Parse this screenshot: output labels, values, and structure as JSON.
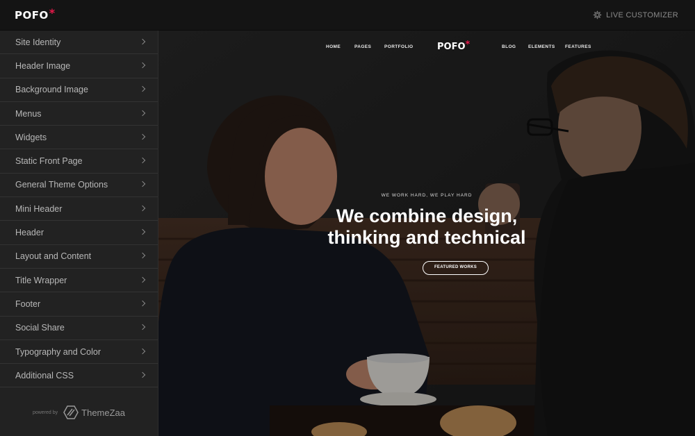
{
  "topbar": {
    "brand": "POFO",
    "brand_mark": "*",
    "live_label": "LIVE CUSTOMIZER",
    "live_icon": "gear-icon"
  },
  "sidebar": {
    "items": [
      {
        "label": "Site Identity"
      },
      {
        "label": "Header Image"
      },
      {
        "label": "Background Image"
      },
      {
        "label": "Menus"
      },
      {
        "label": "Widgets"
      },
      {
        "label": "Static Front Page"
      },
      {
        "label": "General Theme Options"
      },
      {
        "label": "Mini Header"
      },
      {
        "label": "Header"
      },
      {
        "label": "Layout and Content"
      },
      {
        "label": "Title Wrapper"
      },
      {
        "label": "Footer"
      },
      {
        "label": "Social Share"
      },
      {
        "label": "Typography and Color"
      },
      {
        "label": "Additional CSS"
      }
    ],
    "powered_by": "powered by",
    "vendor": "ThemeZaa"
  },
  "preview": {
    "nav": {
      "home": "HOME",
      "pages": "PAGES",
      "portfolio": "PORTFOLIO",
      "logo": "POFO",
      "logo_mark": "*",
      "blog": "BLOG",
      "elements": "ELEMENTS",
      "features": "FEATURES"
    },
    "tagline": "WE WORK HARD, WE PLAY HARD",
    "headline_line1": "We combine design,",
    "headline_line2": "thinking and technical",
    "cta": "FEATURED WORKS"
  },
  "colors": {
    "accent": "#e8194a",
    "topbar_bg": "#141414",
    "sidebar_bg": "#222222",
    "sidebar_text": "#b8b8b8"
  }
}
